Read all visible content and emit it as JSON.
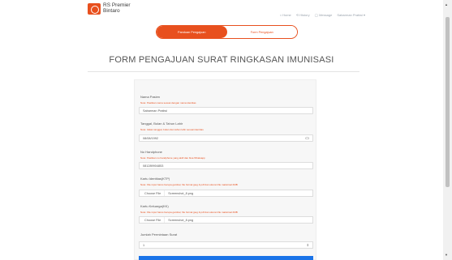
{
  "header": {
    "brand_line1": "RS Premier",
    "brand_line2": "Bintaro",
    "nav": [
      {
        "icon": "home-icon",
        "glyph": "⌂",
        "label": "Home"
      },
      {
        "icon": "history-icon",
        "glyph": "⟲",
        "label": "History"
      },
      {
        "icon": "message-icon",
        "glyph": "◯",
        "label": "Message"
      },
      {
        "icon": "",
        "glyph": "",
        "label": "Sabarman Pratiwi ▾"
      }
    ]
  },
  "steps": {
    "step1": "Panduan Pengajuan",
    "step2": "Form Pengajuan"
  },
  "page_title": "FORM PENGAJUAN SURAT RINGKASAN IMUNISASI",
  "form": {
    "nama": {
      "label": "Nama Pasien",
      "note": "Note: Pastikan nama sesuai dengan nama identitas",
      "value": "Sabarman Pratiwi"
    },
    "ttl": {
      "label": "Tanggal, Bulan & Tahun Lahir",
      "note": "Note: Isikan tanggal, bulan dan tahun lahir sesuai identitas",
      "value": "08/08/1992"
    },
    "hp": {
      "label": "No Handphone",
      "note": "Note: Pastikan no handphone yang aktif dan bisa Whatsapp",
      "value": "081289904853"
    },
    "ktp": {
      "label": "Kartu Identitas(KTP)",
      "note": "Note: File input harus berupa gambar, file format jpeg & pdf dan ukuran file maksimal 2MB",
      "button": "Choose File",
      "file": "Screenshot_8.png"
    },
    "kk": {
      "label": "Kartu Keluarga(KK)",
      "note": "Note: File input harus berupa gambar, file format jpeg & pdf dan ukuran file maksimal 2MB",
      "button": "Choose File",
      "file": "Screenshot_8.png"
    },
    "jumlah": {
      "label": "Jumlah Permintaan Surat",
      "value": "1"
    }
  },
  "colors": {
    "accent": "#e8501e",
    "submit": "#1a73e8"
  }
}
